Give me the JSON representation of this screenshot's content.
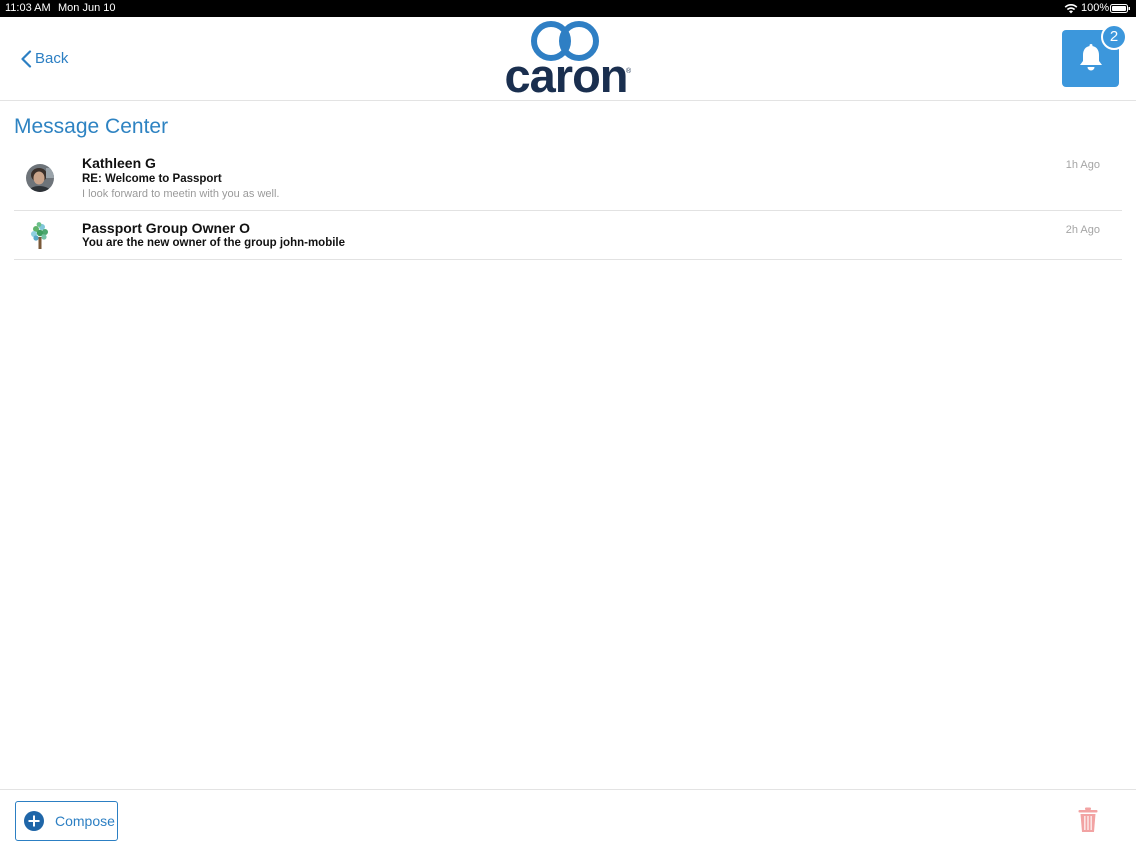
{
  "status_bar": {
    "time": "11:03 AM",
    "date": "Mon Jun 10",
    "battery": "100%"
  },
  "header": {
    "back_label": "Back",
    "logo_text": "caron",
    "logo_reg": "®",
    "notification_count": "2"
  },
  "page": {
    "title": "Message Center"
  },
  "messages": [
    {
      "sender": "Kathleen G",
      "subject": "RE: Welcome to Passport",
      "preview": "I look forward to meetin with you as well.",
      "time": "1h Ago",
      "avatar": "photo-avatar"
    },
    {
      "sender": "Passport Group Owner O",
      "subject": "You are the new owner of the group john-mobile",
      "preview": "",
      "time": "2h Ago",
      "avatar": "tree-icon"
    }
  ],
  "footer": {
    "compose_label": "Compose"
  },
  "colors": {
    "accent": "#2c7fc3",
    "bell_bg": "#3c97dc",
    "logo_navy": "#1a2f4f",
    "trash": "#f2a3a3"
  }
}
